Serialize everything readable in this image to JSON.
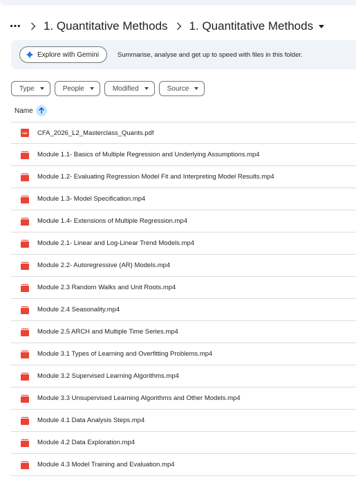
{
  "breadcrumb": {
    "overflow": "⋯",
    "items": [
      "1. Quantitative Methods",
      "1. Quantitative Methods"
    ]
  },
  "gemini": {
    "button_label": "Explore with Gemini",
    "description": "Summarise, analyse and get up to speed with files in this folder."
  },
  "filters": [
    "Type",
    "People",
    "Modified",
    "Source"
  ],
  "list_header": {
    "name_label": "Name",
    "sort": "ascending"
  },
  "files": [
    {
      "name": "CFA_2026_L2_Masterclass_Quants.pdf",
      "type": "pdf"
    },
    {
      "name": "Module 1.1- Basics of Multiple Regression and Underlying Assumptions.mp4",
      "type": "video"
    },
    {
      "name": "Module 1.2- Evaluating Regression Model Fit and Interpreting Model Results.mp4",
      "type": "video"
    },
    {
      "name": "Module 1.3- Model Specification.mp4",
      "type": "video"
    },
    {
      "name": "Module 1.4- Extensions of Multiple Regression.mp4",
      "type": "video"
    },
    {
      "name": "Module 2.1- Linear and Log-Linear Trend Models.mp4",
      "type": "video"
    },
    {
      "name": "Module 2.2- Autoregressive (AR) Models.mp4",
      "type": "video"
    },
    {
      "name": "Module 2.3 Random Walks and Unit Roots.mp4",
      "type": "video"
    },
    {
      "name": "Module 2.4 Seasonality.mp4",
      "type": "video"
    },
    {
      "name": "Module 2.5 ARCH and Multiple Time Series.mp4",
      "type": "video"
    },
    {
      "name": "Module 3.1 Types of Learning and Overfitting Problems.mp4",
      "type": "video"
    },
    {
      "name": "Module 3.2 Supervised Learning Algorithms.mp4",
      "type": "video"
    },
    {
      "name": "Module 3.3 Unsupervised Learning Algorithms and Other Models.mp4",
      "type": "video"
    },
    {
      "name": "Module 4.1 Data Analysis Steps.mp4",
      "type": "video"
    },
    {
      "name": "Module 4.2 Data Exploration.mp4",
      "type": "video"
    },
    {
      "name": "Module 4.3 Model Training and Evaluation.mp4",
      "type": "video"
    }
  ],
  "colors": {
    "file_icon_red": "#ea4335",
    "sort_badge": "#c2e7ff",
    "gemini_blue": "#1a73e8"
  }
}
